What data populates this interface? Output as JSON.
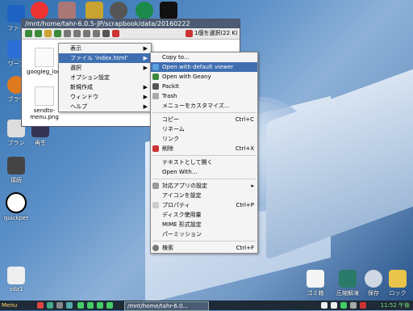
{
  "desktop_icons_left": [
    {
      "label": "ファイ",
      "color": "#1e63c4"
    },
    {
      "label": "ワープ",
      "color": "#2b6fd6"
    },
    {
      "label": "ブラウ",
      "color": "#e07a1f"
    },
    {
      "label": "ブラン",
      "color": "#ddd"
    },
    {
      "label": "再生",
      "color": "#335"
    },
    {
      "label": "接続",
      "color": "#444"
    },
    {
      "label": "quickpet",
      "color": "#fff"
    },
    {
      "label": "sda1",
      "color": "#eee"
    }
  ],
  "top_icons": [
    {
      "name": "lifebuoy-icon",
      "color": "#e33"
    },
    {
      "name": "cat-icon",
      "color": "#a77"
    },
    {
      "name": "bug-icon",
      "color": "#c9a32f"
    },
    {
      "name": "gear-icon",
      "color": "#555"
    },
    {
      "name": "pen-icon",
      "color": "#1b8a4a"
    },
    {
      "name": "terminal-icon",
      "color": "#111"
    }
  ],
  "file_manager": {
    "title": "/mnt/home/tahr-6.0.5-JP/scrapbook/data/20160222",
    "selection_count": "1個を選択(22 K)",
    "files": [
      {
        "name": "googleg_lodp.ico"
      },
      {
        "name": "sendto-menu.png"
      }
    ]
  },
  "context_menu": {
    "items": [
      {
        "label": "表示",
        "has_submenu": true
      },
      {
        "label": "ファイル 'index.html'",
        "has_submenu": true,
        "highlighted": true
      },
      {
        "label": "選択",
        "has_submenu": true
      },
      {
        "label": "オプション設定",
        "has_submenu": false
      },
      {
        "label": "新規作成",
        "has_submenu": true
      },
      {
        "label": "ウィンドウ",
        "has_submenu": true
      },
      {
        "label": "ヘルプ",
        "has_submenu": true
      }
    ]
  },
  "sub_menu": {
    "items": [
      {
        "label": "Copy to...",
        "shortcut": ""
      },
      {
        "label": "Open with default viewer",
        "shortcut": "",
        "highlighted": true
      },
      {
        "label": "Open with Geany",
        "shortcut": ""
      },
      {
        "label": "PackIt",
        "shortcut": ""
      },
      {
        "label": "Trash",
        "shortcut": ""
      },
      {
        "label": "メニューをカスタマイズ...",
        "shortcut": ""
      },
      {
        "sep": true
      },
      {
        "label": "コピー",
        "shortcut": "Ctrl+C"
      },
      {
        "label": "リネーム",
        "shortcut": ""
      },
      {
        "label": "リンク",
        "shortcut": ""
      },
      {
        "label": "削除",
        "shortcut": "Ctrl+X"
      },
      {
        "sep": true
      },
      {
        "label": "テキストとして開く",
        "shortcut": ""
      },
      {
        "label": "Open With...",
        "shortcut": ""
      },
      {
        "sep": true
      },
      {
        "label": "対応アプリの設定",
        "shortcut": "▸"
      },
      {
        "label": "アイコンを設定",
        "shortcut": ""
      },
      {
        "label": "プロパティ",
        "shortcut": "Ctrl+P"
      },
      {
        "label": "ディスク使用量",
        "shortcut": ""
      },
      {
        "label": "MIME 形式設定",
        "shortcut": ""
      },
      {
        "label": "パーミッション",
        "shortcut": ""
      },
      {
        "sep": true
      },
      {
        "label": "検索",
        "shortcut": "Ctrl+F"
      }
    ]
  },
  "desktop_icons_right": [
    {
      "label": "ゴミ箱"
    },
    {
      "label": "圧縮解凍"
    },
    {
      "label": "保存"
    },
    {
      "label": "ロック"
    }
  ],
  "taskbar": {
    "menu_label": "Menu",
    "window_label": "/mnt/home/tahr-6.0...",
    "clock": "11:52 午後"
  }
}
